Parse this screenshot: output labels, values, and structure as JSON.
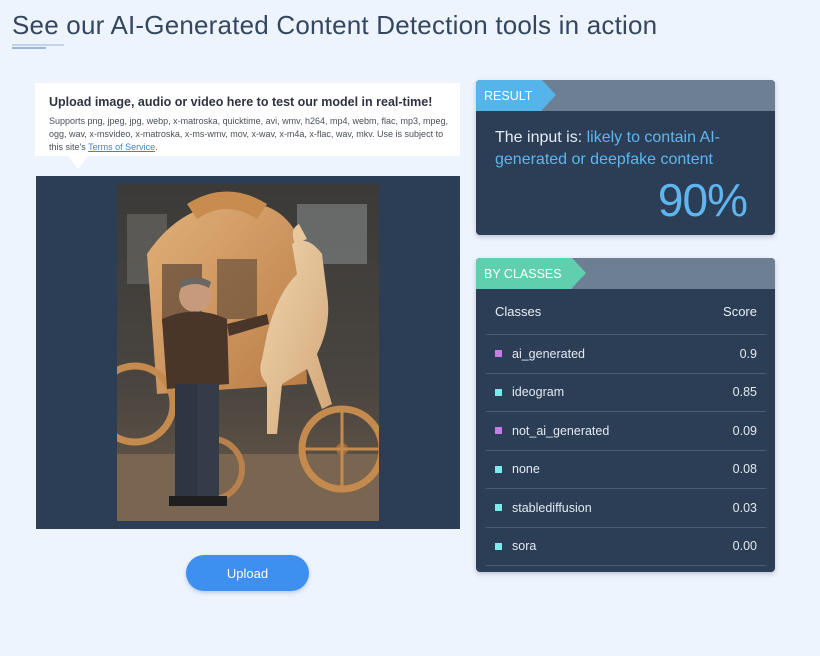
{
  "page": {
    "title": "See our AI-Generated Content Detection tools in action"
  },
  "upload": {
    "heading": "Upload image, audio or video here to test our model in real-time!",
    "description": "Supports png, jpeg, jpg, webp, x-matroska, quicktime, avi, wmv, h264, mp4, webm, flac, mp3, mpeg, ogg, wav, x-msvideo, x-matroska, x-ms-wmv, mov, x-wav, x-m4a, x-flac, wav, mkv. Use is subject to this site's ",
    "terms_link": "Terms of Service",
    "description_end": ".",
    "button_label": "Upload"
  },
  "result": {
    "tag": "RESULT",
    "prefix": "The input is: ",
    "verdict": "likely to contain AI-generated or deepfake content",
    "score": "90%"
  },
  "classes": {
    "tag": "BY CLASSES",
    "col_class": "Classes",
    "col_score": "Score",
    "rows": [
      {
        "name": "ai_generated",
        "score": "0.9",
        "color": "#c77fe8"
      },
      {
        "name": "ideogram",
        "score": "0.85",
        "color": "#7ee8ec"
      },
      {
        "name": "not_ai_generated",
        "score": "0.09",
        "color": "#c77fe8"
      },
      {
        "name": "none",
        "score": "0.08",
        "color": "#7ee8ec"
      },
      {
        "name": "stablediffusion",
        "score": "0.03",
        "color": "#7ee8ec"
      },
      {
        "name": "sora",
        "score": "0.00",
        "color": "#7ee8ec"
      }
    ]
  },
  "colors": {
    "page_bg": "#eef4fd",
    "card_bg": "#2c3e55",
    "header_bg": "#6d7f93",
    "result_tag": "#55b4ea",
    "classes_tag": "#5fcfae",
    "accent": "#5eb6f0",
    "button": "#3d8ff0"
  }
}
